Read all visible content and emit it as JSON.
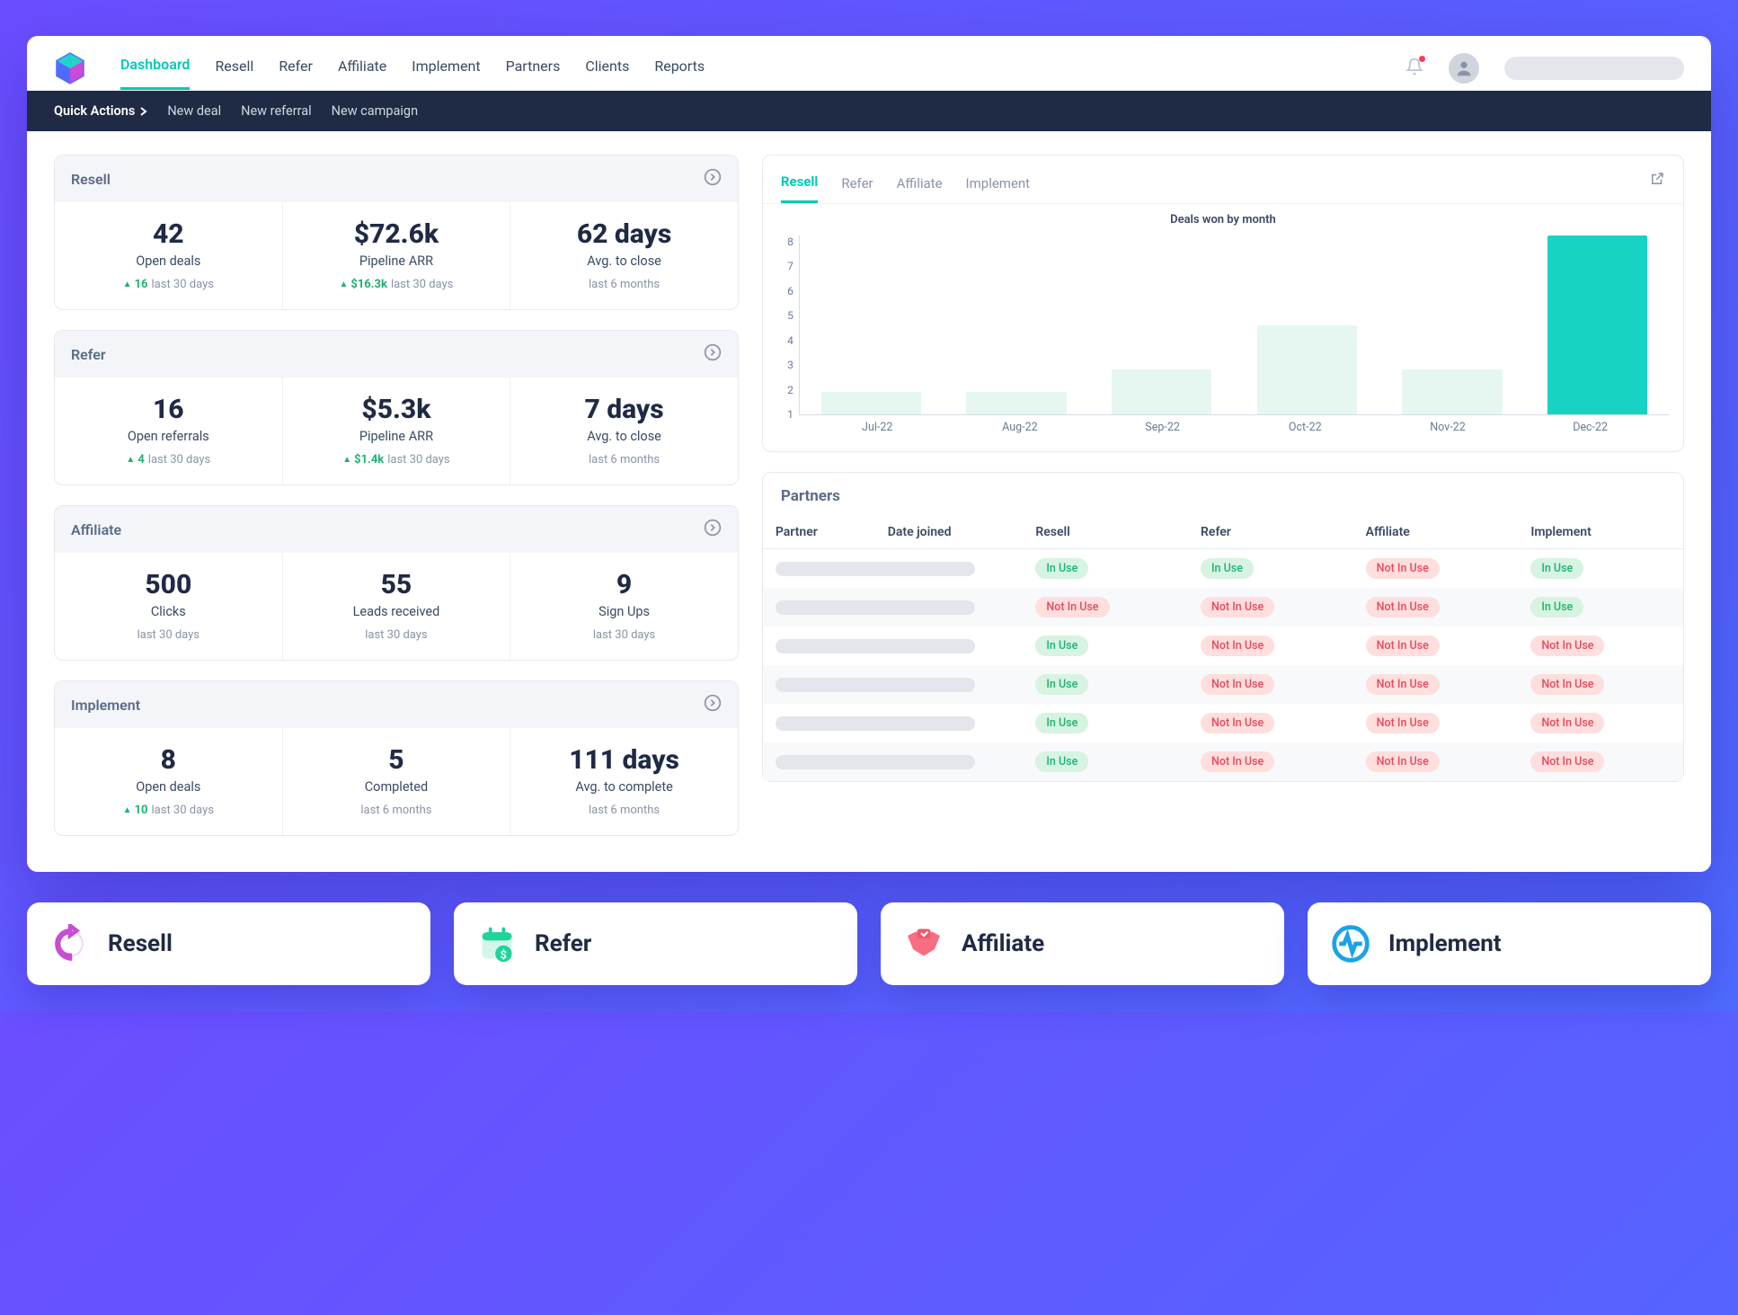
{
  "nav": {
    "items": [
      "Dashboard",
      "Resell",
      "Refer",
      "Affiliate",
      "Implement",
      "Partners",
      "Clients",
      "Reports"
    ],
    "active": "Dashboard"
  },
  "quick_actions": {
    "label": "Quick Actions",
    "items": [
      "New deal",
      "New referral",
      "New campaign"
    ]
  },
  "panels": {
    "resell": {
      "title": "Resell",
      "metrics": [
        {
          "value": "42",
          "label": "Open deals",
          "trend_up": "16",
          "trend_caption": "last 30 days"
        },
        {
          "value": "$72.6k",
          "label": "Pipeline ARR",
          "trend_up": "$16.3k",
          "trend_caption": "last 30 days"
        },
        {
          "value": "62 days",
          "label": "Avg. to close",
          "trend_up": null,
          "trend_caption": "last 6 months"
        }
      ]
    },
    "refer": {
      "title": "Refer",
      "metrics": [
        {
          "value": "16",
          "label": "Open referrals",
          "trend_up": "4",
          "trend_caption": "last 30 days"
        },
        {
          "value": "$5.3k",
          "label": "Pipeline ARR",
          "trend_up": "$1.4k",
          "trend_caption": "last 30 days"
        },
        {
          "value": "7 days",
          "label": "Avg. to close",
          "trend_up": null,
          "trend_caption": "last 6 months"
        }
      ]
    },
    "affiliate": {
      "title": "Affiliate",
      "metrics": [
        {
          "value": "500",
          "label": "Clicks",
          "trend_up": null,
          "trend_caption": "last 30 days"
        },
        {
          "value": "55",
          "label": "Leads received",
          "trend_up": null,
          "trend_caption": "last 30 days"
        },
        {
          "value": "9",
          "label": "Sign Ups",
          "trend_up": null,
          "trend_caption": "last 30 days"
        }
      ]
    },
    "implement": {
      "title": "Implement",
      "metrics": [
        {
          "value": "8",
          "label": "Open deals",
          "trend_up": "10",
          "trend_caption": "last 30 days"
        },
        {
          "value": "5",
          "label": "Completed",
          "trend_up": null,
          "trend_caption": "last 6 months"
        },
        {
          "value": "111 days",
          "label": "Avg. to complete",
          "trend_up": null,
          "trend_caption": "last 6 months"
        }
      ]
    }
  },
  "chart": {
    "tabs": [
      "Resell",
      "Refer",
      "Affiliate",
      "Implement"
    ],
    "active": "Resell",
    "title": "Deals won by month"
  },
  "chart_data": {
    "type": "bar",
    "categories": [
      "Jul-22",
      "Aug-22",
      "Sep-22",
      "Oct-22",
      "Nov-22",
      "Dec-22"
    ],
    "values": [
      1,
      1,
      2,
      4,
      2,
      8
    ],
    "highlight_index": 5,
    "title": "Deals won by month",
    "xlabel": "",
    "ylabel": "",
    "ylim": [
      0,
      8
    ],
    "yticks": [
      1,
      2,
      3,
      4,
      5,
      6,
      7,
      8
    ]
  },
  "partners": {
    "title": "Partners",
    "columns": [
      "Partner",
      "Date joined",
      "Resell",
      "Refer",
      "Affiliate",
      "Implement"
    ],
    "badge_labels": {
      "inuse": "In Use",
      "notinuse": "Not In Use"
    },
    "rows": [
      {
        "resell": "inuse",
        "refer": "inuse",
        "affiliate": "notinuse",
        "implement": "inuse"
      },
      {
        "resell": "notinuse",
        "refer": "notinuse",
        "affiliate": "notinuse",
        "implement": "inuse"
      },
      {
        "resell": "inuse",
        "refer": "notinuse",
        "affiliate": "notinuse",
        "implement": "notinuse"
      },
      {
        "resell": "inuse",
        "refer": "notinuse",
        "affiliate": "notinuse",
        "implement": "notinuse"
      },
      {
        "resell": "inuse",
        "refer": "notinuse",
        "affiliate": "notinuse",
        "implement": "notinuse"
      },
      {
        "resell": "inuse",
        "refer": "notinuse",
        "affiliate": "notinuse",
        "implement": "notinuse"
      }
    ]
  },
  "bottom_cards": [
    {
      "label": "Resell",
      "icon": "cycle",
      "color": "#c94bd6"
    },
    {
      "label": "Refer",
      "icon": "calendar-dollar",
      "color": "#1fd39a"
    },
    {
      "label": "Affiliate",
      "icon": "handshake",
      "color": "#f4556a"
    },
    {
      "label": "Implement",
      "icon": "pulse",
      "color": "#1aa3e8"
    }
  ]
}
